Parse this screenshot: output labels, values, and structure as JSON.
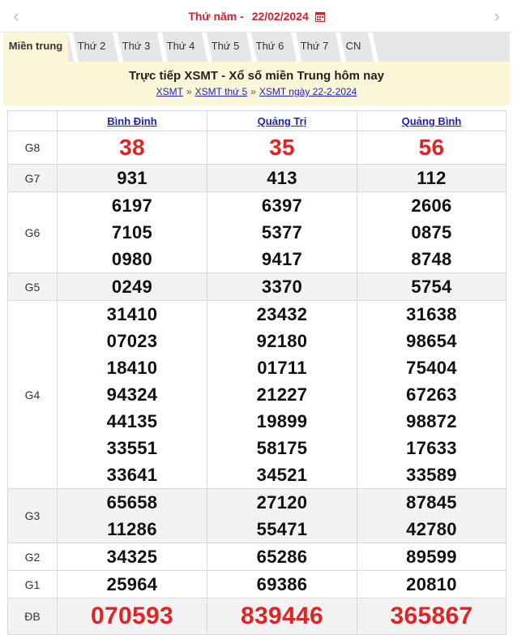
{
  "header": {
    "day": "Thứ năm -",
    "date": "22/02/2024",
    "prev_icon": "chevron-left-icon",
    "next_icon": "chevron-right-icon",
    "calendar_icon": "calendar-icon",
    "accent": "#d0212a"
  },
  "tabs": [
    "Miền trung",
    "Thứ 2",
    "Thứ 3",
    "Thứ 4",
    "Thứ 5",
    "Thứ 6",
    "Thứ 7",
    "CN"
  ],
  "banner": {
    "title": "Trực tiếp XSMT - Xổ số miền Trung hôm nay",
    "crumbs": [
      "XSMT",
      "XSMT thứ 5",
      "XSMT ngày 22-2-2024"
    ],
    "sep": "»"
  },
  "provinces": [
    "Bình Định",
    "Quảng Trị",
    "Quảng Bình"
  ],
  "prizes": [
    {
      "label": "G8",
      "values": [
        [
          "38"
        ],
        [
          "35"
        ],
        [
          "56"
        ]
      ]
    },
    {
      "label": "G7",
      "values": [
        [
          "931"
        ],
        [
          "413"
        ],
        [
          "112"
        ]
      ]
    },
    {
      "label": "G6",
      "values": [
        [
          "6197",
          "7105",
          "0980"
        ],
        [
          "6397",
          "5377",
          "9417"
        ],
        [
          "2606",
          "0875",
          "8748"
        ]
      ]
    },
    {
      "label": "G5",
      "values": [
        [
          "0249"
        ],
        [
          "3370"
        ],
        [
          "5754"
        ]
      ]
    },
    {
      "label": "G4",
      "values": [
        [
          "31410",
          "07023",
          "18410",
          "94324",
          "44135",
          "33551",
          "33641"
        ],
        [
          "23432",
          "92180",
          "01711",
          "21227",
          "19899",
          "58175",
          "34521"
        ],
        [
          "31638",
          "98654",
          "75404",
          "67263",
          "98872",
          "17633",
          "33589"
        ]
      ]
    },
    {
      "label": "G3",
      "values": [
        [
          "65658",
          "11286"
        ],
        [
          "27120",
          "55471"
        ],
        [
          "87845",
          "42780"
        ]
      ]
    },
    {
      "label": "G2",
      "values": [
        [
          "34325"
        ],
        [
          "65286"
        ],
        [
          "89599"
        ]
      ]
    },
    {
      "label": "G1",
      "values": [
        [
          "25964"
        ],
        [
          "69386"
        ],
        [
          "20810"
        ]
      ]
    },
    {
      "label": "ĐB",
      "values": [
        [
          "070593"
        ],
        [
          "839446"
        ],
        [
          "365867"
        ]
      ]
    }
  ]
}
